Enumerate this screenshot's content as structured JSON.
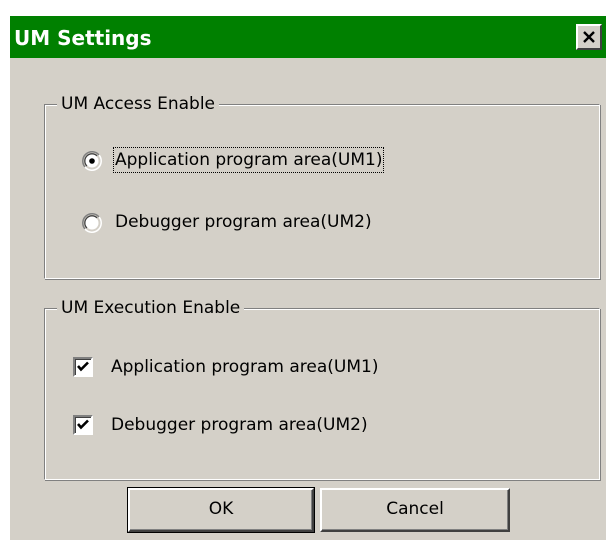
{
  "window": {
    "title": "UM Settings",
    "title_bar_color": "#008000",
    "close_icon": "close-icon"
  },
  "access_group": {
    "label": "UM Access Enable",
    "options": [
      {
        "label": "Application program area(UM1)",
        "selected": true
      },
      {
        "label": "Debugger program area(UM2)",
        "selected": false
      }
    ]
  },
  "execution_group": {
    "label": "UM Execution Enable",
    "options": [
      {
        "label": "Application program area(UM1)",
        "checked": true
      },
      {
        "label": "Debugger program area(UM2)",
        "checked": true
      }
    ]
  },
  "buttons": {
    "ok": "OK",
    "cancel": "Cancel"
  }
}
